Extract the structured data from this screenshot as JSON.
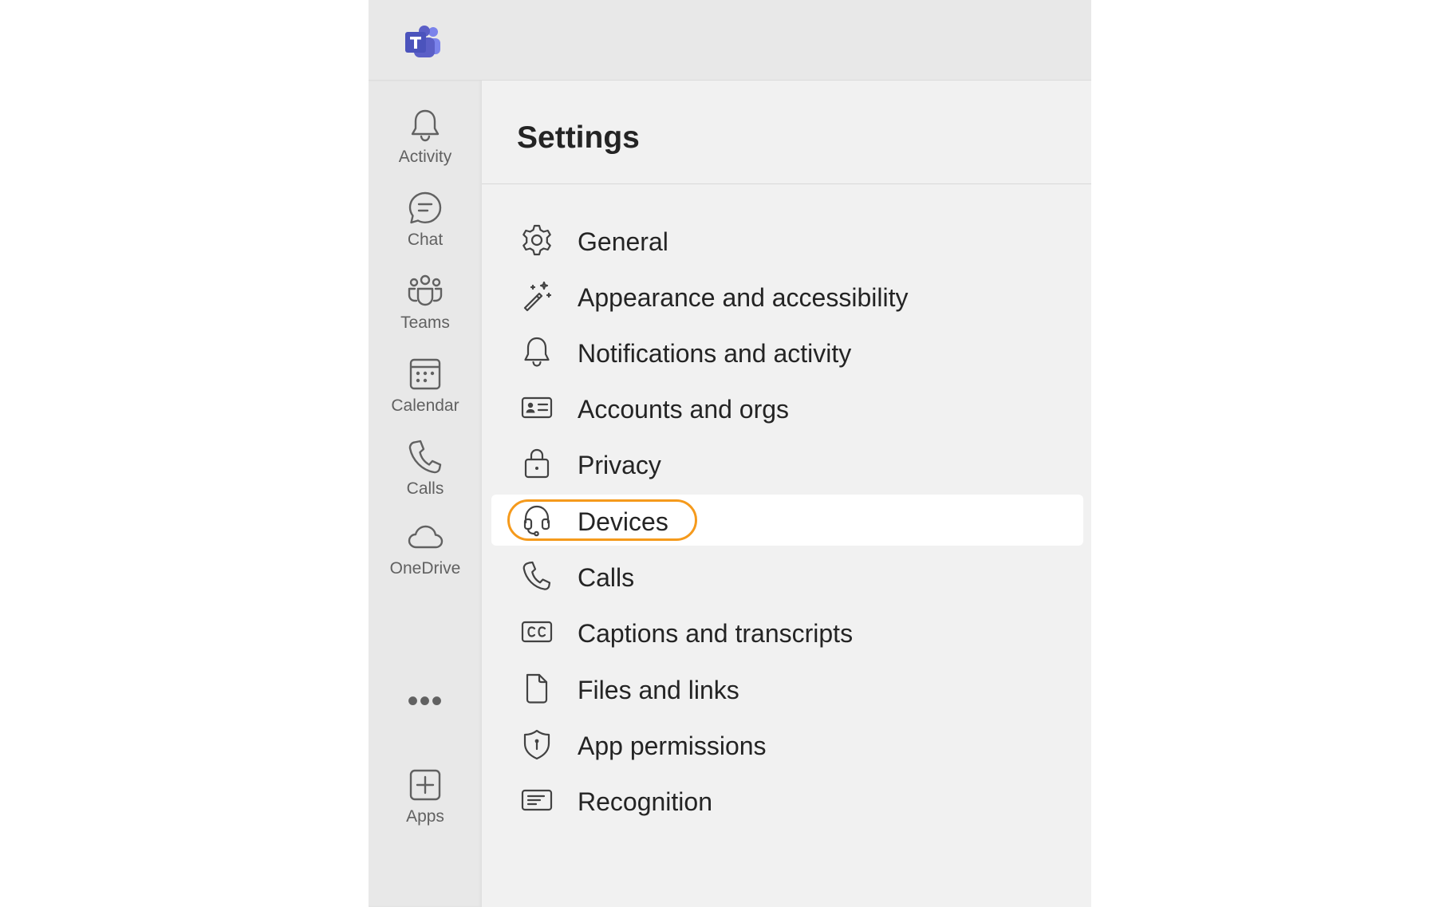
{
  "app": {
    "logo_icon": "teams-logo-icon",
    "brand_color": "#5b5fc7"
  },
  "rail": {
    "items": [
      {
        "label": "Activity",
        "icon": "bell-icon"
      },
      {
        "label": "Chat",
        "icon": "chat-icon"
      },
      {
        "label": "Teams",
        "icon": "teams-people-icon"
      },
      {
        "label": "Calendar",
        "icon": "calendar-icon"
      },
      {
        "label": "Calls",
        "icon": "phone-icon"
      },
      {
        "label": "OneDrive",
        "icon": "cloud-icon"
      },
      {
        "label": "Apps",
        "icon": "add-square-icon"
      }
    ],
    "more_icon": "more-dots-icon",
    "more_text": "•••"
  },
  "settings": {
    "title": "Settings",
    "items": [
      {
        "label": "General",
        "icon": "gear-icon"
      },
      {
        "label": "Appearance and accessibility",
        "icon": "magic-wand-icon"
      },
      {
        "label": "Notifications and activity",
        "icon": "bell-icon"
      },
      {
        "label": "Accounts and orgs",
        "icon": "contact-card-icon"
      },
      {
        "label": "Privacy",
        "icon": "lock-icon"
      },
      {
        "label": "Devices",
        "icon": "headset-icon"
      },
      {
        "label": "Calls",
        "icon": "phone-icon"
      },
      {
        "label": "Captions and transcripts",
        "icon": "closed-captions-icon"
      },
      {
        "label": "Files and links",
        "icon": "document-icon"
      },
      {
        "label": "App permissions",
        "icon": "shield-icon"
      },
      {
        "label": "Recognition",
        "icon": "text-box-icon"
      }
    ],
    "selected": "Devices",
    "highlight_color": "#f59a1c"
  }
}
